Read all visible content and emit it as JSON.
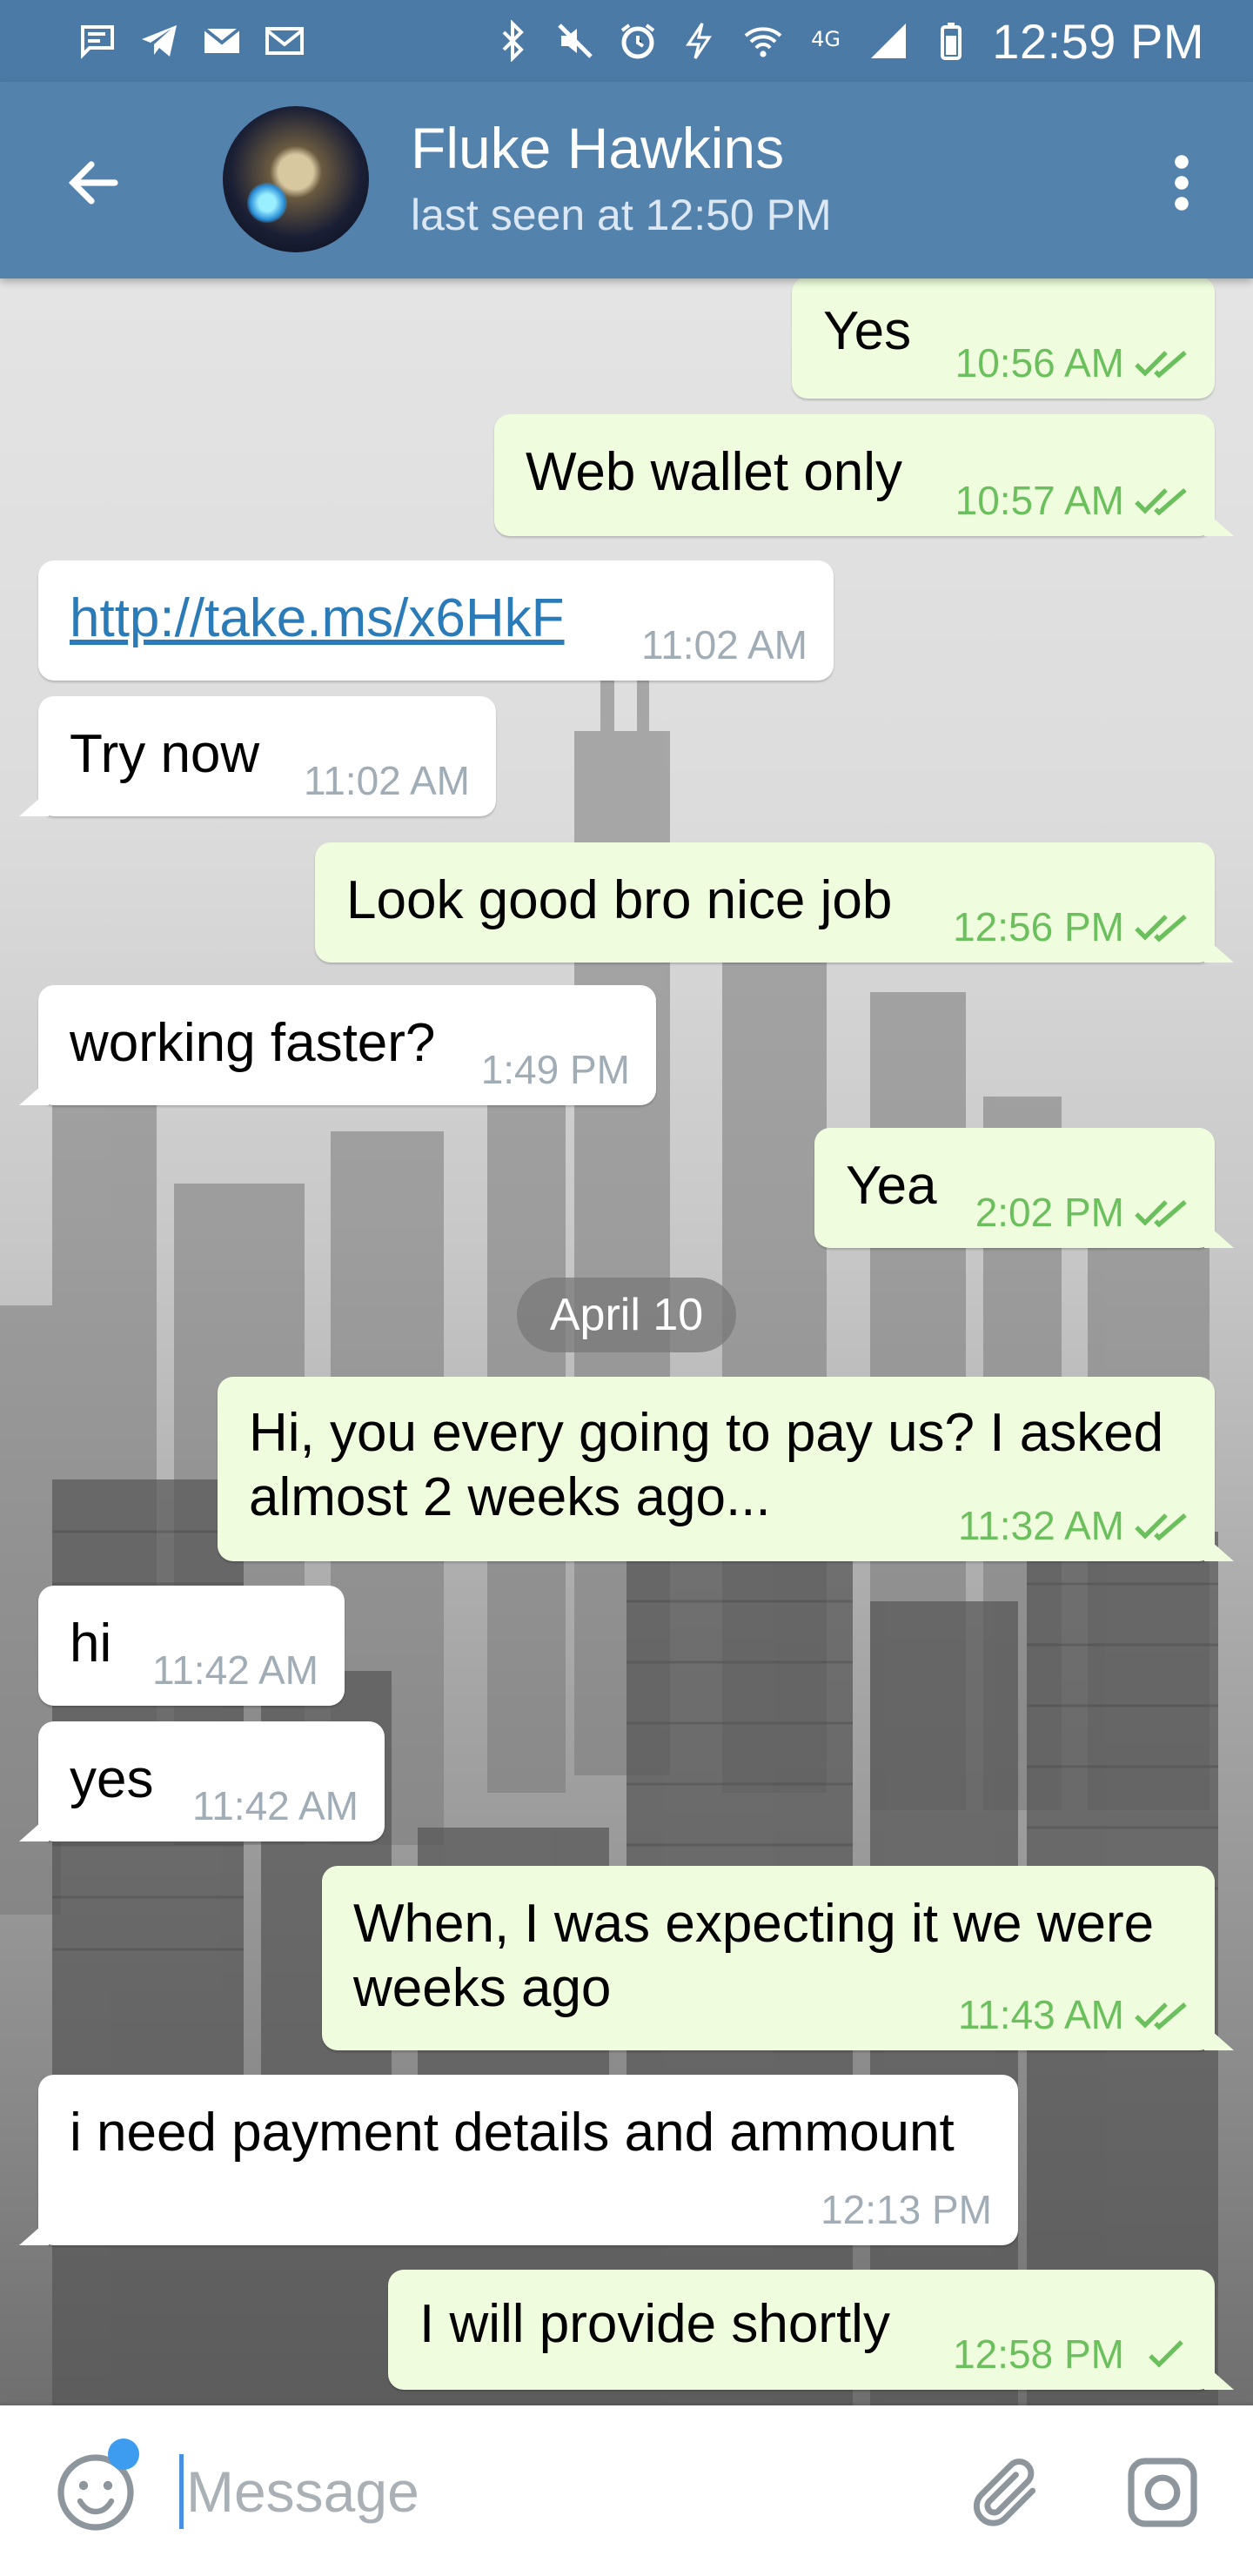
{
  "status_bar": {
    "time": "12:59 PM",
    "left_icons": [
      "message-bubble-icon",
      "telegram-icon",
      "mail-icon",
      "gmail-icon"
    ],
    "right_icons": [
      "bluetooth-icon",
      "mute-icon",
      "alarm-icon",
      "data-saver-icon",
      "wifi-icon",
      "lte-icon",
      "signal-icon",
      "battery-icon"
    ],
    "network_label": "4G"
  },
  "header": {
    "contact_name": "Fluke Hawkins",
    "last_seen": "last seen at 12:50 PM"
  },
  "date_divider": "April 10",
  "messages": [
    {
      "direction": "out",
      "text": "Yes",
      "time": "10:56 AM",
      "status": "read"
    },
    {
      "direction": "out",
      "text": "Web wallet only",
      "time": "10:57 AM",
      "status": "read"
    },
    {
      "direction": "in",
      "text": "http://take.ms/x6HkF",
      "time": "11:02 AM",
      "is_link": true
    },
    {
      "direction": "in",
      "text": "Try now",
      "time": "11:02 AM"
    },
    {
      "direction": "out",
      "text": "Look good bro nice job",
      "time": "12:56 PM",
      "status": "read"
    },
    {
      "direction": "in",
      "text": "working faster?",
      "time": "1:49 PM"
    },
    {
      "direction": "out",
      "text": "Yea",
      "time": "2:02 PM",
      "status": "read"
    },
    {
      "direction": "out",
      "lines": [
        "Hi, you every going to pay us? I asked",
        "almost 2 weeks ago..."
      ],
      "time": "11:32 AM",
      "status": "read"
    },
    {
      "direction": "in",
      "text": "hi",
      "time": "11:42 AM"
    },
    {
      "direction": "in",
      "text": "yes",
      "time": "11:42 AM"
    },
    {
      "direction": "out",
      "lines": [
        "When, I was expecting it we were",
        "weeks ago"
      ],
      "time": "11:43 AM",
      "status": "read"
    },
    {
      "direction": "in",
      "text": "i need payment details and ammount",
      "time": "12:13 PM"
    },
    {
      "direction": "out",
      "text": "I will provide shortly",
      "time": "12:58 PM",
      "status": "sent"
    }
  ],
  "input": {
    "placeholder": "Message",
    "value": ""
  },
  "colors": {
    "header": "#5382ad",
    "status_bar": "#4c7aa6",
    "outgoing_bubble": "#effdde",
    "incoming_bubble": "#ffffff",
    "outgoing_meta": "#6cbf5d",
    "incoming_meta": "#a0acb6",
    "link": "#2b7bb9"
  }
}
